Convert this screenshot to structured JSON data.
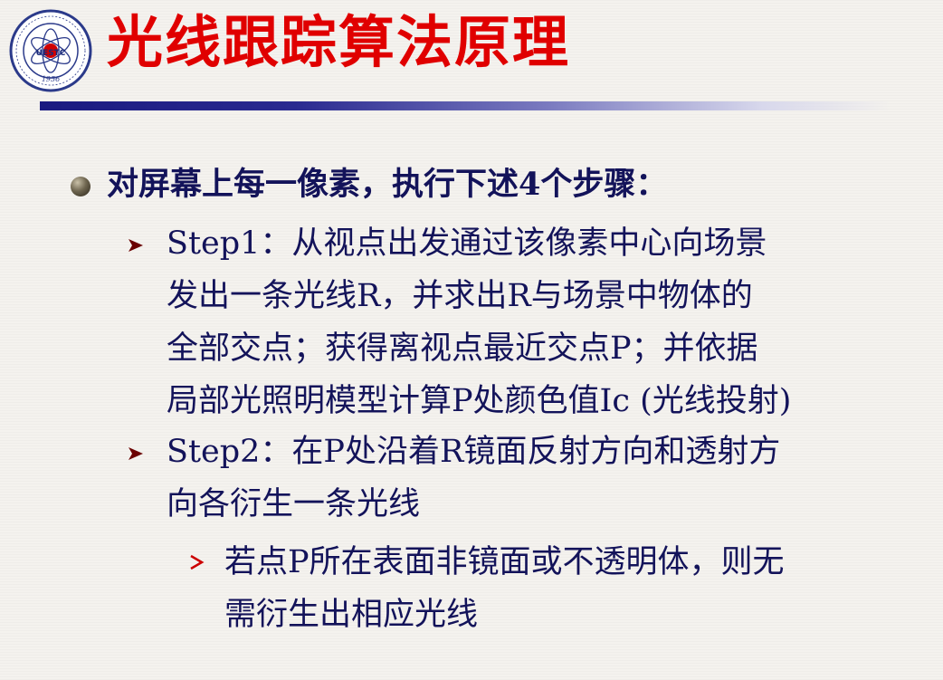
{
  "header": {
    "title": "光线跟踪算法原理",
    "logo": {
      "name": "uestc-seal",
      "text": "UESTC",
      "year": "1956"
    }
  },
  "content": {
    "intro": "对屏幕上每一像素，执行下述4个步骤：",
    "steps": [
      {
        "lines": [
          "Step1：从视点出发通过该像素中心向场景",
          "发出一条光线R，并求出R与场景中物体的",
          "全部交点；获得离视点最近交点P；并依据",
          "局部光照明模型计算P处颜色值Ic (光线投射)"
        ]
      },
      {
        "lines": [
          "Step2：在P处沿着R镜面反射方向和透射方",
          "向各衍生一条光线"
        ],
        "sub": {
          "lines": [
            "若点P所在表面非镜面或不透明体，则无",
            "需衍生出相应光线"
          ]
        }
      }
    ]
  },
  "colors": {
    "title": "#e00000",
    "text": "#13135a",
    "rule": "#1a1a80",
    "bullet_arrow": "#6b0000",
    "sub_chevron": "#cc0000"
  }
}
